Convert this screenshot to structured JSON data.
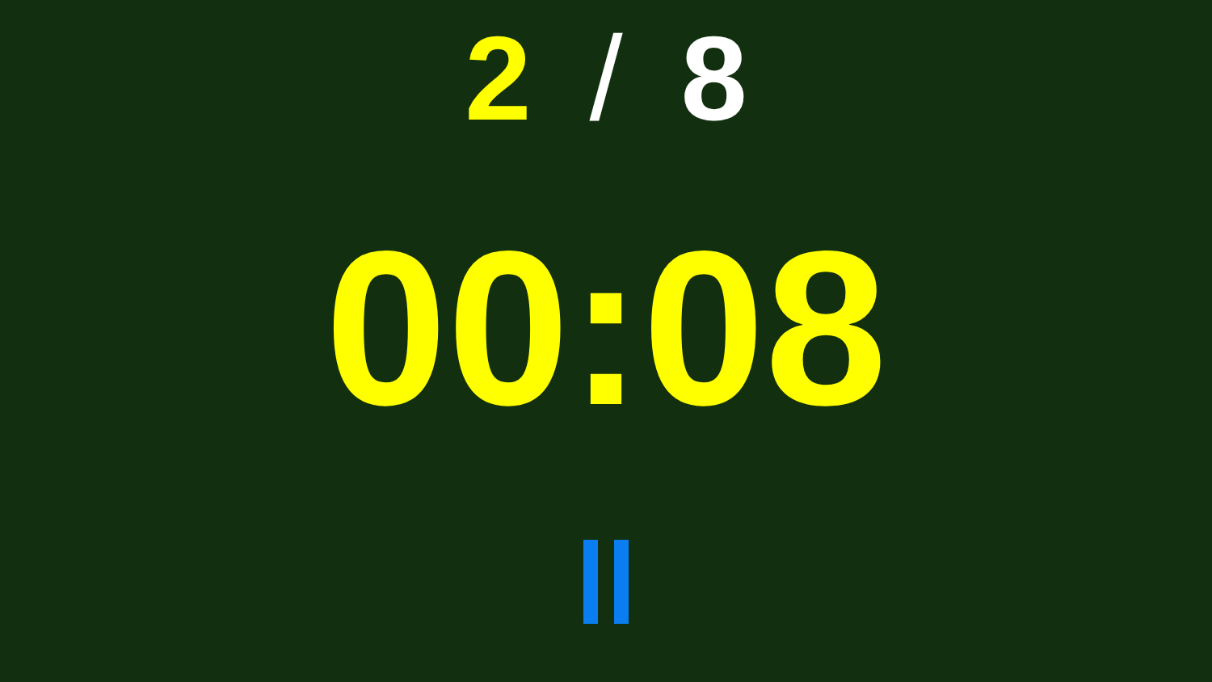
{
  "round": {
    "current": "2",
    "separator": "/",
    "total": "8"
  },
  "timer": "00:08",
  "control": {
    "paused": false
  }
}
